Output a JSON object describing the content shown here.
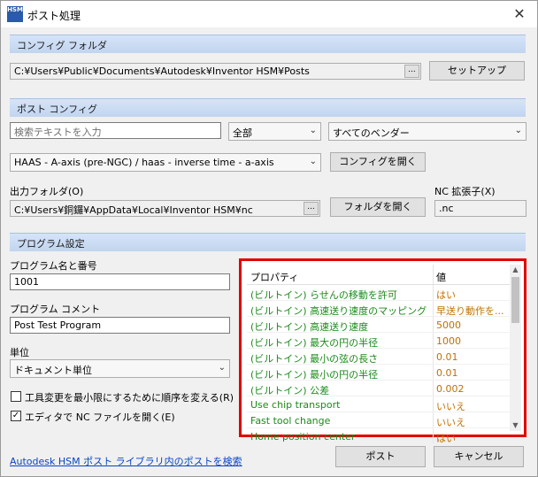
{
  "window": {
    "title": "ポスト処理",
    "app_icon_text": "HSM",
    "close_symbol": "✕"
  },
  "config_folder": {
    "section_title": "コンフィグ フォルダ",
    "path": "C:¥Users¥Public¥Documents¥Autodesk¥Inventor HSM¥Posts",
    "browse_label": "...",
    "setup_button": "セットアップ"
  },
  "post_config": {
    "section_title": "ポスト コンフィグ",
    "search_placeholder": "検索テキストを入力",
    "filter_all": "全部",
    "vendor_filter": "すべてのベンダー",
    "selected_post": "HAAS - A-axis (pre-NGC) / haas - inverse time - a-axis",
    "open_config_button": "コンフィグを開く"
  },
  "output": {
    "folder_label": "出力フォルダ(O)",
    "folder_path": "C:¥Users¥銅鑼¥AppData¥Local¥Inventor HSM¥nc",
    "browse_label": "...",
    "open_folder_button": "フォルダを開く",
    "nc_ext_label": "NC 拡張子(X)",
    "nc_ext_value": ".nc"
  },
  "program": {
    "section_title": "プログラム設定",
    "name_label": "プログラム名と番号",
    "name_value": "1001",
    "comment_label": "プログラム コメント",
    "comment_value": "Post Test Program",
    "unit_label": "単位",
    "unit_value": "ドキュメント単位",
    "reorder_label": "工具変更を最小限にするために順序を変える(R)",
    "reorder_checked": false,
    "open_editor_label": "エディタで NC ファイルを開く(E)",
    "open_editor_checked": true,
    "check_symbol": "✓"
  },
  "properties": {
    "header_property": "プロパティ",
    "header_value": "値",
    "rows": [
      {
        "name": "(ビルトイン) らせんの移動を許可",
        "value": "はい"
      },
      {
        "name": "(ビルトイン) 高速送り速度のマッピング",
        "value": "早送り動作を..."
      },
      {
        "name": "(ビルトイン) 高速送り速度",
        "value": "5000"
      },
      {
        "name": "(ビルトイン) 最大の円の半径",
        "value": "1000"
      },
      {
        "name": "(ビルトイン) 最小の弦の長さ",
        "value": "0.01"
      },
      {
        "name": "(ビルトイン) 最小の円の半径",
        "value": "0.01"
      },
      {
        "name": "(ビルトイン) 公差",
        "value": "0.002"
      },
      {
        "name": "Use chip transport",
        "value": "いいえ"
      },
      {
        "name": "Fast tool change",
        "value": "いいえ"
      },
      {
        "name": "Home position center",
        "value": "はい"
      }
    ],
    "scroll_up": "▲",
    "scroll_down": "▼"
  },
  "footer": {
    "library_link": "Autodesk HSM ポスト ライブラリ内のポストを検索",
    "post_button": "ポスト",
    "cancel_button": "キャンセル"
  },
  "icons": {
    "dropdown_arrow": "⌄"
  }
}
